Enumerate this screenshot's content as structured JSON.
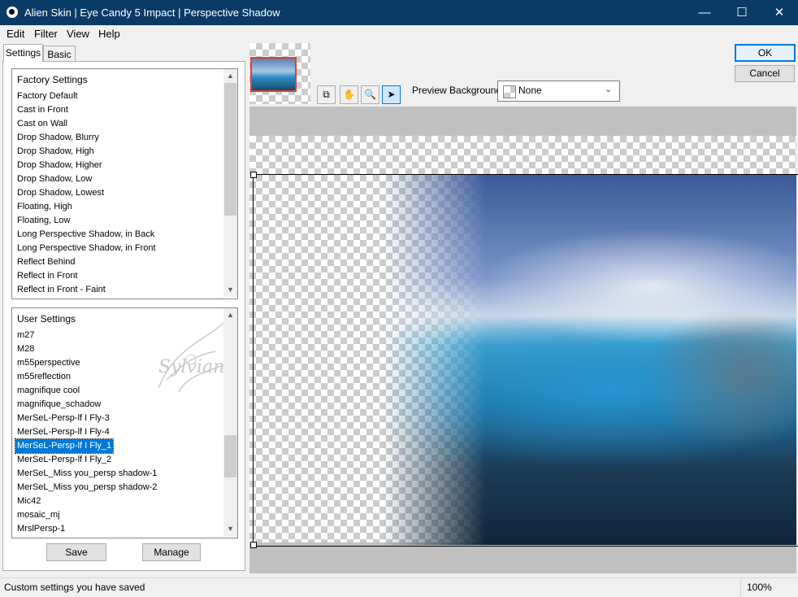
{
  "window": {
    "title": "Alien Skin | Eye Candy 5 Impact | Perspective Shadow",
    "minimize": "—",
    "maximize": "☐",
    "close": "✕"
  },
  "menu": [
    "Edit",
    "Filter",
    "View",
    "Help"
  ],
  "tabs": [
    "Settings",
    "Basic"
  ],
  "factory_settings": {
    "heading": "Factory Settings",
    "items": [
      "Factory Default",
      "Cast in Front",
      "Cast on Wall",
      "Drop Shadow, Blurry",
      "Drop Shadow, High",
      "Drop Shadow, Higher",
      "Drop Shadow, Low",
      "Drop Shadow, Lowest",
      "Floating, High",
      "Floating, Low",
      "Long Perspective Shadow, in Back",
      "Long Perspective Shadow, in Front",
      "Reflect Behind",
      "Reflect in Front",
      "Reflect in Front - Faint"
    ]
  },
  "user_settings": {
    "heading": "User Settings",
    "items": [
      "m27",
      "M28",
      "m55perspective",
      "m55reflection",
      "magnifique cool",
      "magnifique_schadow",
      "MerSeL-Persp-lf I Fly-3",
      "MerSeL-Persp-lf I Fly-4",
      "MerSeL-Persp-lf I Fly_1",
      "MerSeL-Persp-lf I Fly_2",
      "MerSeL_Miss you_persp shadow-1",
      "MerSeL_Miss you_persp shadow-2",
      "Mic42",
      "mosaic_mj",
      "MrslPersp-1"
    ],
    "selected": "MerSeL-Persp-lf I Fly_1"
  },
  "watermark": "Sylviane",
  "buttons": {
    "save": "Save",
    "manage": "Manage",
    "ok": "OK",
    "cancel": "Cancel"
  },
  "preview": {
    "background_label": "Preview Background:",
    "background_value": "None",
    "tools": [
      "preview-toggle-icon",
      "hand-icon",
      "zoom-icon",
      "pointer-icon"
    ]
  },
  "status": {
    "message": "Custom settings you have saved",
    "zoom": "100%"
  },
  "colors": {
    "titlebar": "#0a3b66",
    "selection": "#0078d7",
    "accent_border": "#e0402c"
  }
}
